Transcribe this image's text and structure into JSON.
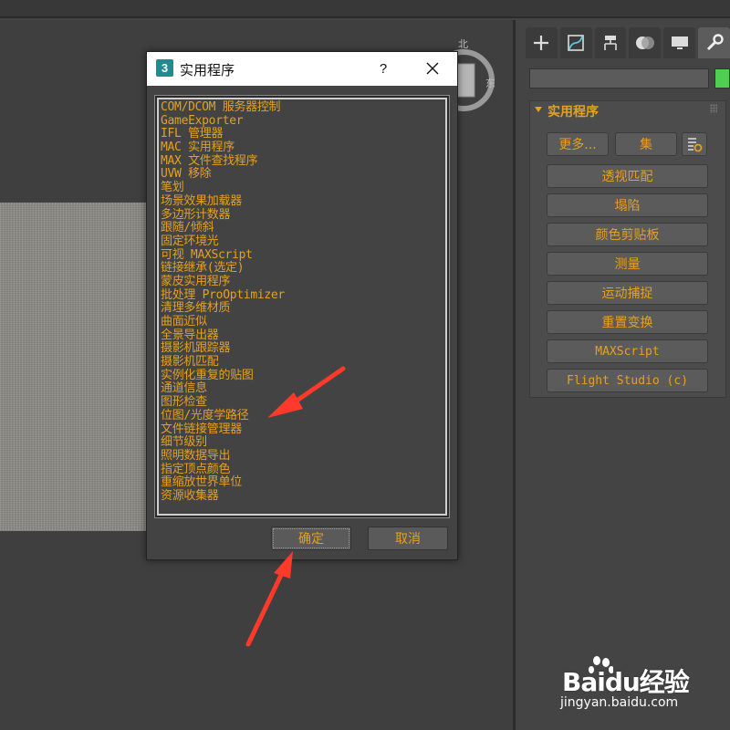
{
  "dialog": {
    "title": "实用程序",
    "help_label": "?",
    "ok_label": "确定",
    "cancel_label": "取消",
    "items": [
      "COM/DCOM 服务器控制",
      "GameExporter",
      "IFL 管理器",
      "MAC 实用程序",
      "MAX 文件查找程序",
      "UVW 移除",
      "笔划",
      "场景效果加载器",
      "多边形计数器",
      "跟随/倾斜",
      "固定环境光",
      "可视 MAXScript",
      "链接继承(选定)",
      "蒙皮实用程序",
      "批处理 ProOptimizer",
      "清理多维材质",
      "曲面近似",
      "全景导出器",
      "摄影机跟踪器",
      "摄影机匹配",
      "实例化重复的贴图",
      "通道信息",
      "图形检查",
      "位图/光度学路径",
      "文件链接管理器",
      "细节级别",
      "照明数据导出",
      "指定顶点颜色",
      "重缩放世界单位",
      "资源收集器"
    ]
  },
  "panel": {
    "rollout_title": "实用程序",
    "more_label": "更多...",
    "sets_label": "集",
    "buttons": [
      "透视匹配",
      "塌陷",
      "颜色剪贴板",
      "测量",
      "运动捕捉",
      "重置变换",
      "MAXScript",
      "Flight Studio (c)"
    ]
  },
  "viewcube": {
    "north": "北",
    "east": "东"
  },
  "watermark": {
    "brand": "Baidu经验",
    "url": "jingyan.baidu.com"
  },
  "colors": {
    "accent_text": "#e4a11f",
    "annotation_arrow": "#ff3a2a",
    "object_color_swatch": "#4fcf4f",
    "dialog_icon": "#1f8c8e"
  },
  "icons": {
    "tab_create": "plus-icon",
    "tab_modify": "modify-curve-icon",
    "tab_hierarchy": "hierarchy-icon",
    "tab_motion": "motion-icon",
    "tab_display": "display-monitor-icon",
    "tab_utilities": "wrench-icon",
    "sets_config": "configure-sets-icon",
    "close": "close-icon"
  }
}
